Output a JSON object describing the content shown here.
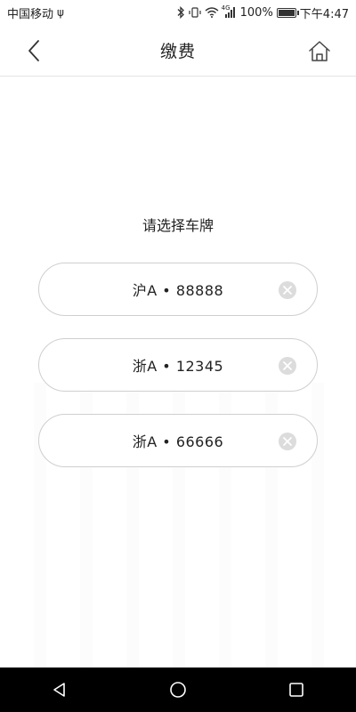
{
  "status_bar": {
    "carrier": "中国移动",
    "usb_symbol": "ψ",
    "network": "4G",
    "battery": "100%",
    "battery_level": 1.0,
    "time": "下午4:47"
  },
  "nav": {
    "title": "缴费"
  },
  "content": {
    "prompt": "请选择车牌",
    "plates": [
      {
        "label": "沪A • 88888"
      },
      {
        "label": "浙A • 12345"
      },
      {
        "label": "浙A • 66666"
      }
    ]
  },
  "icons": {
    "back": "chevron-left-icon",
    "home": "home-icon",
    "clear": "clear-circle-icon",
    "sys_back": "triangle-back-icon",
    "sys_home": "circle-home-icon",
    "sys_recent": "square-recent-icon"
  },
  "colors": {
    "background": "#ffffff",
    "text": "#222222",
    "border": "#cfcfcf",
    "clear_icon": "#d6d6d6",
    "system_nav": "#000000"
  }
}
